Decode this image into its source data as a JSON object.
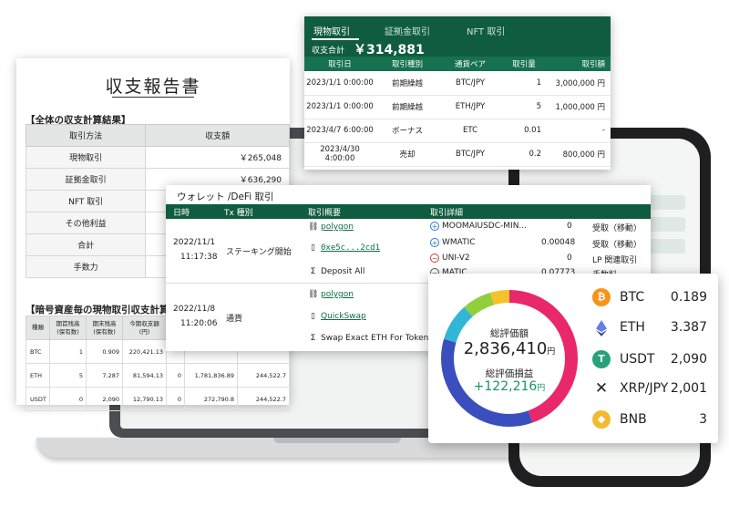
{
  "report": {
    "title": "収支報告書",
    "section1": "【全体の収支計算結果】",
    "headers": [
      "取引方法",
      "収支額"
    ],
    "rows": [
      {
        "label": "現物取引",
        "value": "￥265,048"
      },
      {
        "label": "証拠金取引",
        "value": "￥636,290"
      },
      {
        "label": "NFT 取引",
        "value": ""
      },
      {
        "label": "その他利益",
        "value": ""
      },
      {
        "label": "合計",
        "value": ""
      },
      {
        "label": "手数力",
        "value": ""
      }
    ],
    "section2": "【暗号資産毎の現物取引収支計算",
    "t2_headers": [
      "種類",
      "期首残高\n(保有数)",
      "期末残高\n(保有数)",
      "今期収支額\n(円)",
      "",
      "",
      ""
    ],
    "t2_rows": [
      [
        "BTC",
        "1",
        "0.909",
        "220,421.13",
        "",
        "",
        ""
      ],
      [
        "ETH",
        "5",
        "7.287",
        "81,594.13",
        "0",
        "1,781,836.89",
        "244,522.7"
      ],
      [
        "USDT",
        "0",
        "2,090",
        "12,790.13",
        "0",
        "272,790.8",
        "244,522.7"
      ]
    ]
  },
  "trade": {
    "tabs": [
      "現物取引",
      "証拠金取引",
      "NFT 取引"
    ],
    "total_label": "収支合計",
    "total_value": "￥314,881",
    "headers": [
      "取引日",
      "取引種別",
      "通貨ペア",
      "取引量",
      "取引額"
    ],
    "rows": [
      [
        "2023/1/1 0:00:00",
        "前期繰越",
        "BTC/JPY",
        "1",
        "3,000,000 円"
      ],
      [
        "2023/1/1 0:00:00",
        "前期繰越",
        "ETH/JPY",
        "5",
        "1,000,000 円"
      ],
      [
        "2023/4/7 6:00:00",
        "ボーナス",
        "ETC",
        "0.01",
        "-"
      ],
      [
        "2023/4/30 4:00:00",
        "売却",
        "BTC/JPY",
        "0.2",
        "800,000 円"
      ]
    ]
  },
  "defi": {
    "title": "ウォレット /DeFi 取引",
    "headers": [
      "日時",
      "Tx 種別",
      "取引概要",
      "取引詳細"
    ],
    "tx1": {
      "date": "2022/11/1",
      "time": "11:17:38",
      "type": "ステーキング開始",
      "summary": [
        "polygon",
        "0xe5c...2cd1",
        "Deposit All"
      ],
      "details": [
        {
          "token": "MOOMAIUSDC-MIN...",
          "amount": "0",
          "note": "受取（移動）"
        },
        {
          "token": "WMATIC",
          "amount": "0.00048",
          "note": "受取（移動）"
        },
        {
          "token": "UNI-V2",
          "amount": "0",
          "note": "LP 関連取引"
        },
        {
          "token": "MATIC",
          "amount": "0.07773",
          "note": "手数料"
        }
      ]
    },
    "tx2": {
      "date": "2022/11/8",
      "time": "11:20:06",
      "type": "通貨",
      "summary": [
        "polygon",
        "QuickSwap",
        "Swap Exact ETH For Tokens"
      ]
    }
  },
  "portfolio": {
    "total_label": "総評価額",
    "total_value": "2,836,410",
    "total_unit": "円",
    "pnl_label": "総評価損益",
    "pnl_value": "+122,216",
    "pnl_unit": "円",
    "assets": [
      {
        "name": "BTC",
        "value": "0.189",
        "icon": "bitcoin-icon",
        "color": "#f7931a"
      },
      {
        "name": "ETH",
        "value": "3.387",
        "icon": "ethereum-icon",
        "color": "#627eea"
      },
      {
        "name": "USDT",
        "value": "2,090",
        "icon": "tether-icon",
        "color": "#26a17b"
      },
      {
        "name": "XRP/JPY",
        "value": "2,001",
        "icon": "xrp-icon",
        "color": "#222222"
      },
      {
        "name": "BNB",
        "value": "3",
        "icon": "bnb-icon",
        "color": "#f3ba2f"
      }
    ],
    "donut_colors": [
      "#e9276b",
      "#3a4fbd",
      "#31b6d8",
      "#92cf3c",
      "#f6c22b"
    ],
    "accent": "#0f5c40",
    "positive_color": "#17936a"
  }
}
